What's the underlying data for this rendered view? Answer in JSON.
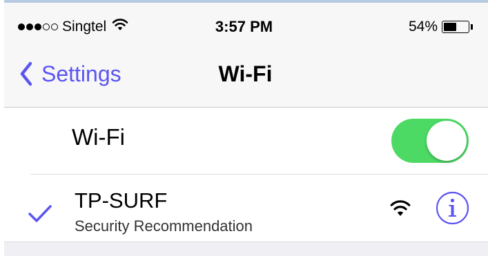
{
  "status_bar": {
    "signal_bars_filled": 3,
    "signal_bars_total": 5,
    "carrier": "Singtel",
    "time": "3:57 PM",
    "battery_percent_text": "54%",
    "battery_level": 0.54
  },
  "nav": {
    "back_label": "Settings",
    "title": "Wi-Fi"
  },
  "wifi_toggle": {
    "label": "Wi-Fi",
    "on": true
  },
  "network": {
    "name": "TP-SURF",
    "subtitle": "Security Recommendation",
    "connected": true
  },
  "colors": {
    "accent": "#5b55f1",
    "toggle_on": "#4cd964",
    "nav_background": "#f7f7f7",
    "separator": "#c8c7cc"
  },
  "icons": {
    "signal": "signal-dots-icon",
    "status_wifi": "wifi-icon",
    "battery": "battery-icon",
    "back": "chevron-left-icon",
    "checkmark": "checkmark-icon",
    "network_signal": "wifi-signal-icon",
    "info": "info-icon"
  }
}
